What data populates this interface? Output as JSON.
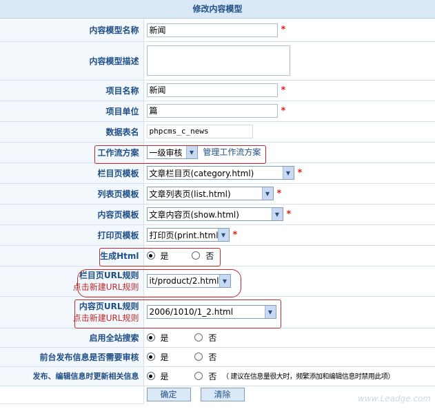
{
  "title": "修改内容模型",
  "fields": {
    "model_name": {
      "label": "内容模型名称",
      "value": "新闻",
      "required": "*"
    },
    "model_desc": {
      "label": "内容模型描述",
      "value": ""
    },
    "item_name": {
      "label": "项目名称",
      "value": "新闻",
      "required": "*"
    },
    "item_unit": {
      "label": "项目单位",
      "value": "篇",
      "required": "*"
    },
    "table_name": {
      "label": "数据表名",
      "value": "phpcms_c_news"
    },
    "workflow": {
      "label": "工作流方案",
      "value": "一级审核",
      "link": "管理工作流方案"
    },
    "category_tpl": {
      "label": "栏目页模板",
      "value": "文章栏目页(category.html)",
      "required": "*"
    },
    "list_tpl": {
      "label": "列表页模板",
      "value": "文章列表页(list.html)",
      "required": "*"
    },
    "content_tpl": {
      "label": "内容页模板",
      "value": "文章内容页(show.html)",
      "required": "*"
    },
    "print_tpl": {
      "label": "打印页模板",
      "value": "打印页(print.html)",
      "required": "*"
    },
    "gen_html": {
      "label": "生成Html",
      "yes": "是",
      "no": "否"
    },
    "cat_url_rule": {
      "label": "栏目页URL规则",
      "sublabel": "点击新建URL规则",
      "value": "it/product/2.html"
    },
    "content_url_rule": {
      "label": "内容页URL规则",
      "sublabel": "点击新建URL规则",
      "value": "2006/1010/1_2.html"
    },
    "site_search": {
      "label": "启用全站搜索",
      "yes": "是",
      "no": "否"
    },
    "front_audit": {
      "label": "前台发布信息是否需要审核",
      "yes": "是",
      "no": "否"
    },
    "update_related": {
      "label": "发布、编辑信息时更新相关信息",
      "yes": "是",
      "no": "否",
      "note": "（ 建议在信息量很大时，频繁添加和编辑信息时禁用此项）"
    }
  },
  "buttons": {
    "ok": "确定",
    "reset": "清除"
  },
  "watermark": "www.Leadge.com",
  "colors": {
    "accent": "#1f4f86",
    "required": "#e02020",
    "highlight_box": "#c0282a",
    "header_bg": "#d9e8f7"
  }
}
